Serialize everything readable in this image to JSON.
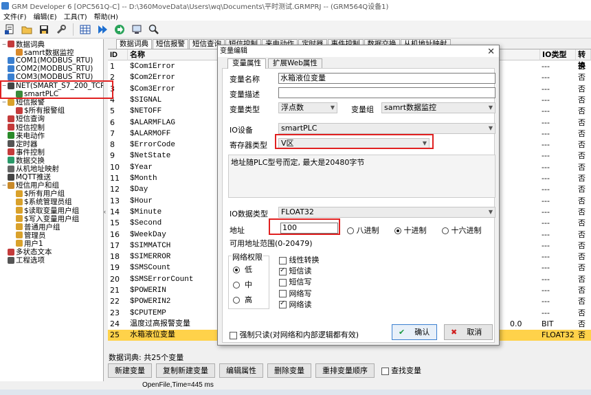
{
  "window": {
    "title": "GRM Developer 6 [OPC561Q-C]  -- D:\\360MoveData\\Users\\wq\\Documents\\平时测试.GRMPRJ -- (GRM564Q设备1)"
  },
  "menu": [
    "文件(F)",
    "编辑(E)",
    "工具(T)",
    "帮助(H)"
  ],
  "toolbar": [
    "new-file-icon",
    "open-folder-icon",
    "save-icon",
    "wrench-icon",
    "grid-icon",
    "play-icon",
    "forward-icon",
    "monitor-icon",
    "zoom-icon"
  ],
  "tree": [
    {
      "label": "数据词典",
      "indent": 0,
      "expand": "−"
    },
    {
      "label": "samrt数据监控",
      "indent": 1
    },
    {
      "label": "COM1(MODBUS_RTU)",
      "indent": 0
    },
    {
      "label": "COM2(MODBUS_RTU)",
      "indent": 0
    },
    {
      "label": "COM3(MODBUS_RTU)",
      "indent": 0
    },
    {
      "label": "NET(SMART_S7_200_TCP)",
      "indent": 0,
      "expand": "−"
    },
    {
      "label": "smartPLC",
      "indent": 1
    },
    {
      "label": "短信报警",
      "indent": 0,
      "expand": "−"
    },
    {
      "label": "$所有报警组",
      "indent": 1
    },
    {
      "label": "短信查询",
      "indent": 0
    },
    {
      "label": "短信控制",
      "indent": 0
    },
    {
      "label": "来电动作",
      "indent": 0
    },
    {
      "label": "定时器",
      "indent": 0
    },
    {
      "label": "事件控制",
      "indent": 0
    },
    {
      "label": "数据交换",
      "indent": 0
    },
    {
      "label": "从机地址映射",
      "indent": 0
    },
    {
      "label": "MQTT推送",
      "indent": 0
    },
    {
      "label": "短信用户和组",
      "indent": 0,
      "expand": "−"
    },
    {
      "label": "$所有用户组",
      "indent": 1
    },
    {
      "label": "$系统管理员组",
      "indent": 1
    },
    {
      "label": "$读取变量用户组",
      "indent": 1
    },
    {
      "label": "$写入变量用户组",
      "indent": 1
    },
    {
      "label": "普通用户组",
      "indent": 1
    },
    {
      "label": "管理员",
      "indent": 1
    },
    {
      "label": "用户1",
      "indent": 1
    },
    {
      "label": "多状态文本",
      "indent": 0
    },
    {
      "label": "工程选项",
      "indent": 0
    }
  ],
  "tabs": [
    "数据词典",
    "短信报警",
    "短信查询",
    "短信控制",
    "来电动作",
    "定时器",
    "事件控制",
    "数据交换",
    "从机地址映射"
  ],
  "table": {
    "headers": {
      "id": "ID",
      "name": "名称",
      "io_type": "IO类型",
      "convert": "转换"
    },
    "rows": [
      {
        "id": "1",
        "name": "$Com1Error",
        "value": "",
        "io": "---",
        "cv": "否"
      },
      {
        "id": "2",
        "name": "$Com2Error",
        "value": "",
        "io": "---",
        "cv": "否"
      },
      {
        "id": "3",
        "name": "$Com3Error",
        "value": "",
        "io": "---",
        "cv": "否"
      },
      {
        "id": "4",
        "name": "$SIGNAL",
        "value": "",
        "io": "---",
        "cv": "否"
      },
      {
        "id": "5",
        "name": "$NETOFF",
        "value": "",
        "io": "---",
        "cv": "否"
      },
      {
        "id": "6",
        "name": "$ALARMFLAG",
        "value": "",
        "io": "---",
        "cv": "否"
      },
      {
        "id": "7",
        "name": "$ALARMOFF",
        "value": "",
        "io": "---",
        "cv": "否"
      },
      {
        "id": "8",
        "name": "$ErrorCode",
        "value": "",
        "io": "---",
        "cv": "否"
      },
      {
        "id": "9",
        "name": "$NetState",
        "value": "",
        "io": "---",
        "cv": "否"
      },
      {
        "id": "10",
        "name": "$Year",
        "value": "",
        "io": "---",
        "cv": "否"
      },
      {
        "id": "11",
        "name": "$Month",
        "value": "",
        "io": "---",
        "cv": "否"
      },
      {
        "id": "12",
        "name": "$Day",
        "value": "",
        "io": "---",
        "cv": "否"
      },
      {
        "id": "13",
        "name": "$Hour",
        "value": "",
        "io": "---",
        "cv": "否"
      },
      {
        "id": "14",
        "name": "$Minute",
        "value": "",
        "io": "---",
        "cv": "否"
      },
      {
        "id": "15",
        "name": "$Second",
        "value": "",
        "io": "---",
        "cv": "否"
      },
      {
        "id": "16",
        "name": "$WeekDay",
        "value": "",
        "io": "---",
        "cv": "否"
      },
      {
        "id": "17",
        "name": "$SIMMATCH",
        "value": "",
        "io": "---",
        "cv": "否"
      },
      {
        "id": "18",
        "name": "$SIMERROR",
        "value": "",
        "io": "---",
        "cv": "否"
      },
      {
        "id": "19",
        "name": "$SMSCount",
        "value": "",
        "io": "---",
        "cv": "否"
      },
      {
        "id": "20",
        "name": "$SMSErrorCount",
        "value": "",
        "io": "---",
        "cv": "否"
      },
      {
        "id": "21",
        "name": "$POWERIN",
        "value": "",
        "io": "---",
        "cv": "否"
      },
      {
        "id": "22",
        "name": "$POWERIN2",
        "value": "",
        "io": "---",
        "cv": "否"
      },
      {
        "id": "23",
        "name": "$CPUTEMP",
        "value": "",
        "io": "---",
        "cv": "否"
      },
      {
        "id": "24",
        "name": "温度过高报警变量",
        "value": "0.0",
        "io": "BIT",
        "cv": "否"
      },
      {
        "id": "25",
        "name": "水箱液位变量",
        "value": "",
        "io": "FLOAT32",
        "cv": "否"
      }
    ],
    "selected_row": "25"
  },
  "footer": {
    "count": "数据词典: 共25个变量"
  },
  "buttons": [
    "新建变量",
    "复制新建变量",
    "编辑属性",
    "删除变量",
    "重排变量顺序"
  ],
  "search_var": "查找变量",
  "status": "OpenFile,Time=445 ms",
  "dialog": {
    "title": "变量编辑",
    "tab_props": "变量属性",
    "tab_web": "扩展Web属性",
    "name_label": "变量名称",
    "name_value": "水箱液位变量",
    "desc_label": "变量描述",
    "desc_value": "",
    "type_label": "变量类型",
    "type_value": "浮点数",
    "group_label": "变量组",
    "group_value": "samrt数据监控",
    "io_label": "IO设备",
    "io_value": "smartPLC",
    "reg_label": "寄存器类型",
    "reg_value": "V区",
    "note": "地址随PLC型号而定, 最大是20480字节",
    "dtype_label": "IO数据类型",
    "dtype_value": "FLOAT32",
    "addr_label": "地址",
    "addr_value": "100",
    "radix": [
      "八进制",
      "十进制",
      "十六进制"
    ],
    "radix_selected": "十进制",
    "range": "可用地址范围(0-20479)",
    "net_label": "网络权限",
    "net_opts": [
      "低",
      "中",
      "高"
    ],
    "net_selected": "低",
    "checks": [
      {
        "label": "线性转换",
        "on": false
      },
      {
        "label": "短信读",
        "on": true
      },
      {
        "label": "短信写",
        "on": false
      },
      {
        "label": "网络写",
        "on": false
      },
      {
        "label": "网络读",
        "on": true
      }
    ],
    "readonly": "强制只读(对网络和内部逻辑都有效)",
    "ok": "确认",
    "cancel": "取消"
  },
  "colors": {
    "selected_row": "#ffd24a",
    "highlight_box": "#e02020",
    "accent": "#3a7fd0"
  }
}
